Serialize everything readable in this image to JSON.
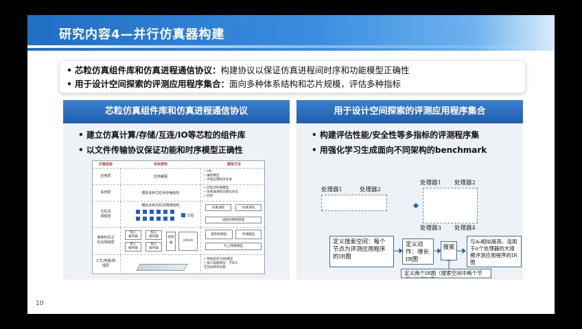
{
  "slide": {
    "title": "研究内容4—并行仿真器构建",
    "page_number": "10"
  },
  "summary": {
    "items": [
      {
        "bullet": "•",
        "bold": "芯粒仿真组件库和仿真进程通信协议：",
        "text": "构建协议以保证仿真进程间时序和功能模型正确性"
      },
      {
        "bullet": "•",
        "bold": "用于设计空间探索的评测应用程序集合：",
        "text": "面向多种体系结构和芯片规模，评估多种指标"
      }
    ]
  },
  "left_panel": {
    "heading": "芯粒仿真组件库和仿真进程通信协议",
    "bullets": [
      "•  建立仿真计算/存储/互连/IO等芯粒的组件库",
      "•  以文件传输协议保证功能和时序模型正确性"
    ],
    "arch": {
      "headers": [
        "仿真层级",
        "目标架构",
        "模拟方法"
      ],
      "rows": [
        {
          "label": "应用层",
          "mid": "应用编程",
          "right": [
            "• API",
            "• 编程模型",
            "• 评测应用程序开发"
          ]
        },
        {
          "label": "系统层",
          "mid": "模拟多种芯粒间存储结构",
          "right": [
            "• 芯粒间存储模型",
            "• 仿真器进程间通信协议",
            "• 同步"
          ]
        },
        {
          "label": "芯粒间\n网络层",
          "mid": "模拟多种芯粒间网络结构",
          "right": [
            "仿真进程",
            "仿真进程",
            "进程间网络管理"
          ]
        },
        {
          "label": "微架构及芯\n粒内网络层",
          "mid": "DRAM",
          "right": [
            "微架构模型",
            "存储模型",
            "片上网络模型"
          ]
        },
        {
          "label": "工艺/电路/物\n理层",
          "mid": "",
          "right": [
            "• 导线延迟/功耗模型",
            "• 接口电路模型：不同工",
            "艺的频率和功耗"
          ]
        }
      ],
      "boxes": [
        "芯粒",
        "仿真进程",
        "仿真进程",
        "进程间网络管理",
        "微架构模型",
        "存储模型",
        "片上网络模型",
        "DRAM",
        "控制器",
        "核心",
        "缓存器",
        "核心",
        "缓存器"
      ]
    }
  },
  "right_panel": {
    "heading": "用于设计空间探索的评测应用程序集合",
    "bullets": [
      "•  构建评估性能/安全性等多指标的评测程序集",
      "•  用强化学习生成面向不同架构的benchmark"
    ],
    "processors": [
      "处理器1",
      "处理器2",
      "处理器1",
      "处理器2",
      "处理器3",
      "处理器4"
    ],
    "steps": {
      "define_space": "定义搜索空间：每个节点为评测应用程序的IR图",
      "define_action": "定义动作：增长IR图",
      "search": "搜索",
      "result": "与A₀相似度高、适用于n个处理器的大规模评测应用程序的IR图",
      "similarity": "定义两个IR图（搜索空间中两个节点）的相似度"
    }
  },
  "colors": {
    "title_blue": "#1f6fc4",
    "panel_head": "#1f5fae",
    "panel_bg": "#eef2f7",
    "chip_blue": "#1f5fbf"
  }
}
